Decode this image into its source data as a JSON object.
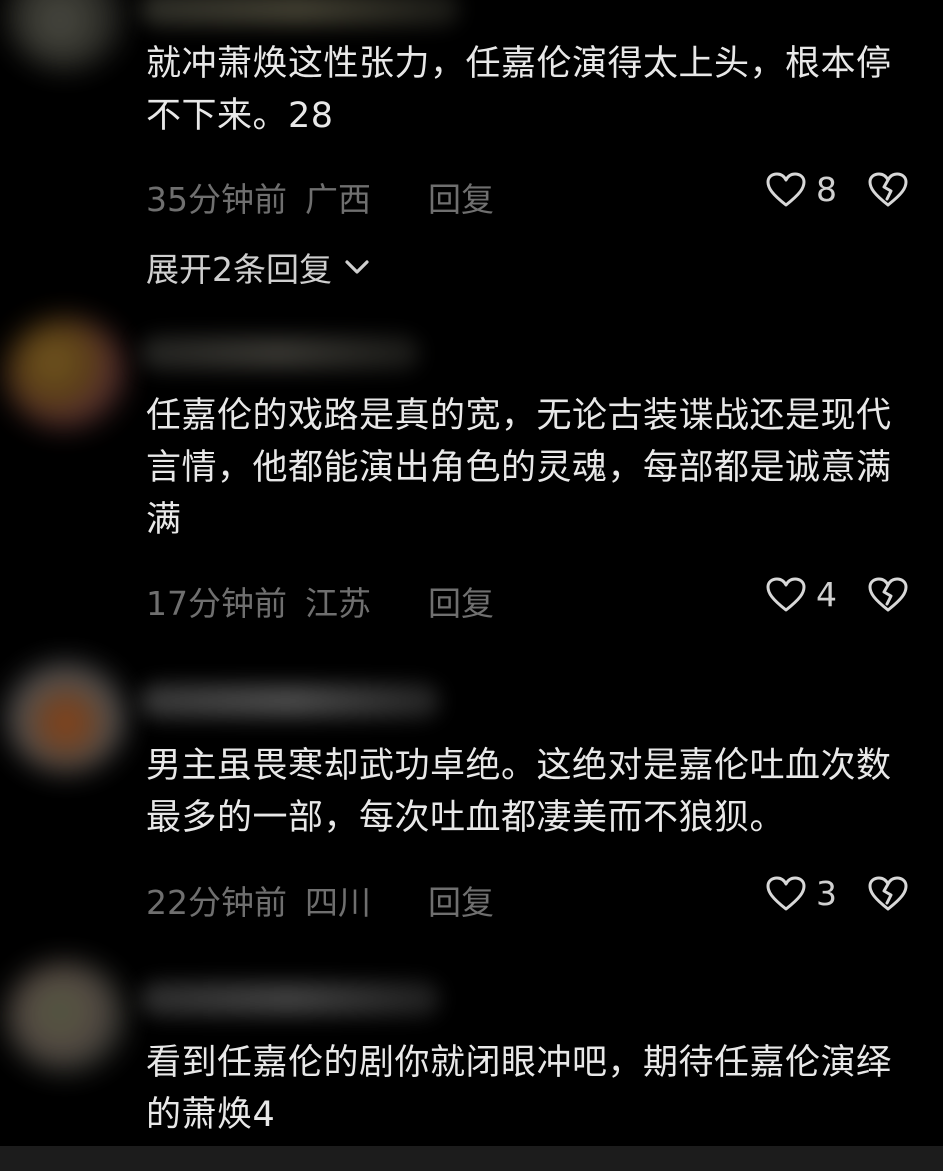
{
  "comments": [
    {
      "text": "就冲萧焕这性张力，任嘉伦演得太上头，根本停不下来。28",
      "time": "35分钟前",
      "location": "广西",
      "reply_label": "回复",
      "likes": "8",
      "expand_label": "展开2条回复"
    },
    {
      "text": "任嘉伦的戏路是真的宽，无论古装谍战还是现代言情，他都能演出角色的灵魂，每部都是诚意满满",
      "time": "17分钟前",
      "location": "江苏",
      "reply_label": "回复",
      "likes": "4"
    },
    {
      "text": "男主虽畏寒却武功卓绝。这绝对是嘉伦吐血次数最多的一部，每次吐血都凄美而不狼狈。",
      "time": "22分钟前",
      "location": "四川",
      "reply_label": "回复",
      "likes": "3"
    },
    {
      "text": "看到任嘉伦的剧你就闭眼冲吧，期待任嘉伦演绎的萧焕4"
    }
  ],
  "icons": {
    "like": "heart-outline-icon",
    "dislike": "broken-heart-outline-icon",
    "expand": "chevron-down-icon"
  },
  "colors": {
    "background": "#000000",
    "text": "#e8e8e8",
    "meta": "#6f6f6f"
  }
}
